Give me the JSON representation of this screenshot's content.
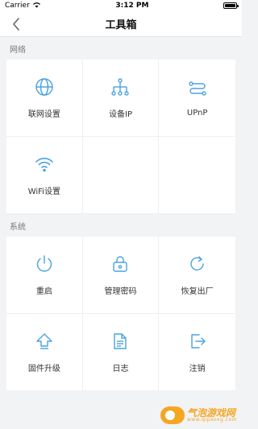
{
  "status_bar": {
    "carrier": "Carrier",
    "time": "3:12 PM",
    "wifi_icon": "wifi-icon",
    "battery_icon": "battery-icon"
  },
  "nav": {
    "title": "工具箱",
    "back_icon": "chevron-left-icon"
  },
  "sections": [
    {
      "title": "网络",
      "items": [
        {
          "label": "联网设置",
          "icon": "globe-icon"
        },
        {
          "label": "设备IP",
          "icon": "network-tree-icon"
        },
        {
          "label": "UPnP",
          "icon": "route-icon"
        },
        {
          "label": "WiFi设置",
          "icon": "wifi-icon"
        }
      ]
    },
    {
      "title": "系统",
      "items": [
        {
          "label": "重启",
          "icon": "power-icon"
        },
        {
          "label": "管理密码",
          "icon": "lock-icon"
        },
        {
          "label": "恢复出厂",
          "icon": "refresh-icon"
        },
        {
          "label": "固件升级",
          "icon": "upgrade-arrow-icon"
        },
        {
          "label": "日志",
          "icon": "document-icon"
        },
        {
          "label": "注销",
          "icon": "logout-icon"
        }
      ]
    }
  ],
  "watermark": {
    "main": "气泡游戏网",
    "sub": "www.qipaoxg.com"
  },
  "colors": {
    "accent": "#4aa3df",
    "background": "#f2f3f5",
    "watermark": "#f5a623"
  }
}
